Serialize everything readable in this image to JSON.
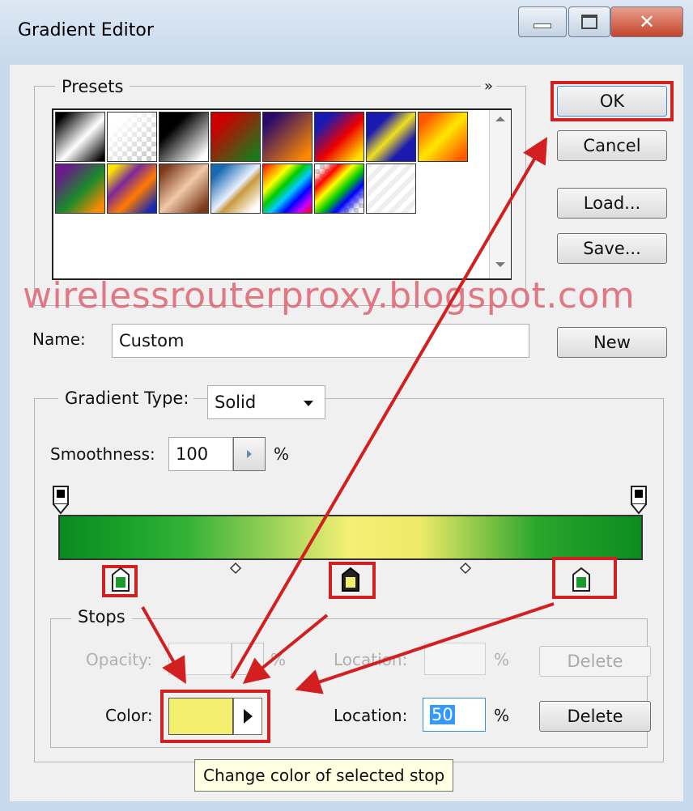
{
  "window": {
    "title": "Gradient Editor"
  },
  "presets": {
    "label": "Presets",
    "menu_glyph": "»",
    "swatches": [
      {
        "name": "black-white"
      },
      {
        "name": "transparent-checker"
      },
      {
        "name": "black-white-reverse"
      },
      {
        "name": "red-green"
      },
      {
        "name": "violet-orange"
      },
      {
        "name": "blue-red-yellow"
      },
      {
        "name": "blue-yellow-blue"
      },
      {
        "name": "orange-yellow-orange"
      },
      {
        "name": "violet-green-orange"
      },
      {
        "name": "yellow-violet-orange-blue"
      },
      {
        "name": "copper"
      },
      {
        "name": "chrome"
      },
      {
        "name": "spectrum"
      },
      {
        "name": "transparent-rainbow"
      },
      {
        "name": "transparent-stripes"
      }
    ]
  },
  "buttons": {
    "ok": "OK",
    "cancel": "Cancel",
    "load": "Load...",
    "save": "Save...",
    "new": "New"
  },
  "watermark": "wirelessrouterproxy.blogspot.com",
  "name_field": {
    "label": "Name:",
    "value": "Custom"
  },
  "gradient_type": {
    "label": "Gradient Type:",
    "value": "Solid"
  },
  "smoothness": {
    "label": "Smoothness:",
    "value": "100",
    "unit": "%"
  },
  "gradient": {
    "colors": [
      "#0a8a1f",
      "#f5f076",
      "#0c8c20"
    ]
  },
  "stops": {
    "label": "Stops",
    "opacity": {
      "label": "Opacity:",
      "value": "",
      "unit": "%",
      "location_label": "Location:",
      "location_value": "",
      "delete": "Delete"
    },
    "color": {
      "label": "Color:",
      "swatch": "#f3ee6e",
      "location_label": "Location:",
      "location_value": "50",
      "unit": "%",
      "delete": "Delete"
    }
  },
  "tooltip": "Change color of selected stop",
  "accent": "#d21f1f"
}
